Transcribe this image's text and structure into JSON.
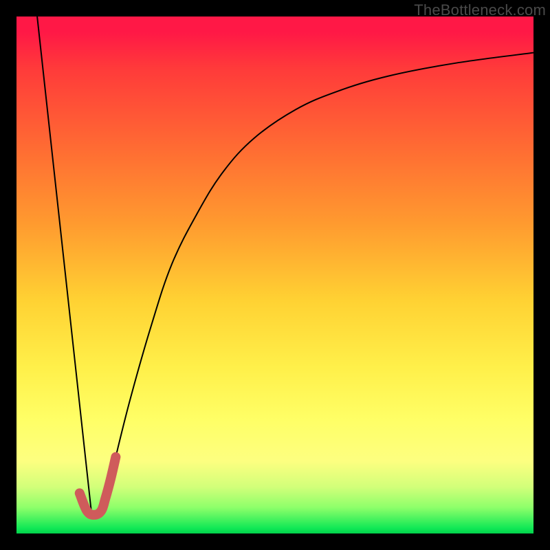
{
  "watermark": "TheBottleneck.com",
  "chart_data": {
    "type": "line",
    "title": "",
    "xlabel": "",
    "ylabel": "",
    "xlim": [
      0,
      100
    ],
    "ylim": [
      0,
      100
    ],
    "grid": false,
    "series": [
      {
        "name": "left-line",
        "stroke": "#000000",
        "width": 2,
        "x": [
          4,
          14.5
        ],
        "y": [
          100,
          4
        ]
      },
      {
        "name": "right-curve",
        "stroke": "#000000",
        "width": 2,
        "x": [
          17,
          19,
          22,
          26,
          30,
          35,
          40,
          46,
          54,
          62,
          72,
          85,
          100
        ],
        "y": [
          5,
          14,
          26,
          40,
          52,
          62,
          70,
          76.5,
          82,
          85.5,
          88.5,
          91,
          93
        ]
      },
      {
        "name": "hook-accent",
        "stroke": "#cf5b5b",
        "width": 14,
        "linecap": "round",
        "x": [
          12.2,
          13.6,
          15.0,
          16.4,
          17.2,
          18.2,
          19.2
        ],
        "y": [
          7.8,
          4.4,
          3.6,
          4.4,
          6.8,
          10.5,
          14.8
        ]
      }
    ]
  }
}
